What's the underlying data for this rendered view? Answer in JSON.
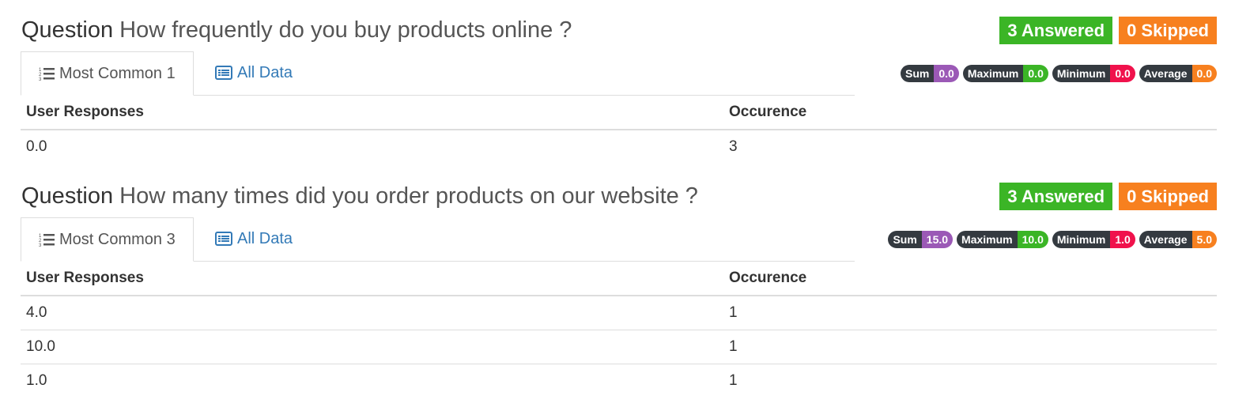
{
  "colors": {
    "answered": "#3bb526",
    "skipped": "#f7801f",
    "sum": "#9b59b6",
    "maximum": "#3bb526",
    "minimum": "#f0124c",
    "average": "#f7801f",
    "link": "#337ab7"
  },
  "questions": [
    {
      "label": "Question",
      "text": "How frequently do you buy products online ?",
      "answered": "3 Answered",
      "skipped": "0 Skipped",
      "tab_common": "Most Common 1",
      "tab_all": "All Data",
      "stats": {
        "sum_label": "Sum",
        "sum": "0.0",
        "max_label": "Maximum",
        "max": "0.0",
        "min_label": "Minimum",
        "min": "0.0",
        "avg_label": "Average",
        "avg": "0.0"
      },
      "headers": [
        "User Responses",
        "Occurence"
      ],
      "rows": [
        [
          "0.0",
          "3"
        ]
      ]
    },
    {
      "label": "Question",
      "text": "How many times did you order products on our website ?",
      "answered": "3 Answered",
      "skipped": "0 Skipped",
      "tab_common": "Most Common 3",
      "tab_all": "All Data",
      "stats": {
        "sum_label": "Sum",
        "sum": "15.0",
        "max_label": "Maximum",
        "max": "10.0",
        "min_label": "Minimum",
        "min": "1.0",
        "avg_label": "Average",
        "avg": "5.0"
      },
      "headers": [
        "User Responses",
        "Occurence"
      ],
      "rows": [
        [
          "4.0",
          "1"
        ],
        [
          "10.0",
          "1"
        ],
        [
          "1.0",
          "1"
        ]
      ]
    }
  ]
}
